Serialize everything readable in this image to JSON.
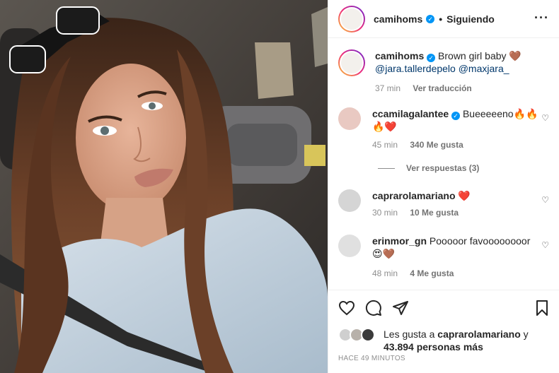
{
  "post": {
    "author": "camihoms",
    "follow_status": "Siguiendo",
    "more_icon": "more-dots-icon",
    "caption": {
      "username": "camihoms",
      "text": "Brown girl baby 🤎",
      "mentions": "@jara.tallerdepelo @maxjara_",
      "time": "37 min",
      "translate": "Ver traducción"
    }
  },
  "comments": [
    {
      "username": "ccamilagalantee",
      "verified": true,
      "text": "Bueeeeeno🔥🔥 🔥❤️",
      "time": "45 min",
      "likes": "340 Me gusta"
    },
    {
      "username": "caprarolamariano",
      "verified": false,
      "text": "❤️",
      "time": "30 min",
      "likes": "10 Me gusta"
    },
    {
      "username": "erinmor_gn",
      "verified": false,
      "text": "Pooooor favoooooooor 😍🤎",
      "time": "48 min",
      "likes": "4 Me gusta"
    }
  ],
  "replies_label": "Ver respuestas (3)",
  "likes_summary": {
    "prefix": "Les gusta a",
    "user": "caprarolamariano",
    "connector": "y",
    "count": "43.894",
    "suffix": "personas más"
  },
  "timestamp": "HACE 49 MINUTOS",
  "colors": {
    "verified": "#0095f6",
    "link": "#00376b",
    "muted": "#8e8e8e",
    "heart": "#ed4956"
  }
}
